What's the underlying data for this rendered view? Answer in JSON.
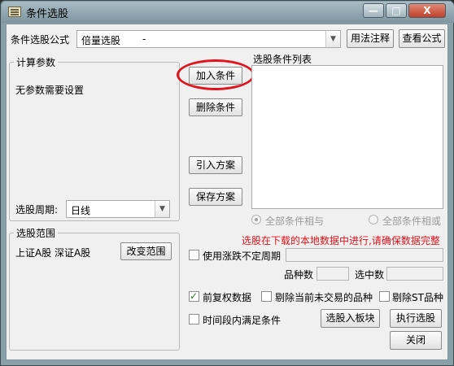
{
  "window": {
    "title": "条件选股",
    "minimize": "—",
    "maximize": "□",
    "close": "X"
  },
  "formula": {
    "label": "条件选股公式",
    "value": "倍量选股",
    "value_suffix": "-",
    "usage_button": "用法注释",
    "view_button": "查看公式"
  },
  "params": {
    "group_label": "计算参数",
    "message": "无参数需要设置",
    "period_label": "选股周期:",
    "period_value": "日线"
  },
  "scope": {
    "group_label": "选股范围",
    "value": "上证A股 深证A股",
    "change_button": "改变范围"
  },
  "actions": {
    "add": "加入条件",
    "delete": "删除条件",
    "import": "引入方案",
    "save": "保存方案"
  },
  "conditions": {
    "list_label": "选股条件列表",
    "all_and": "全部条件相与",
    "all_or": "全部条件相或",
    "all_and_selected": true
  },
  "notice": {
    "text": "选股在下载的本地数据中进行,请确保数据完整",
    "color": "#e0141c"
  },
  "options": {
    "unfixed_period": {
      "label": "使用涨跌不定周期",
      "checked": false
    },
    "count_label": "品种数",
    "selected_label": "选中数",
    "forward_adjust": {
      "label": "前复权数据",
      "checked": true
    },
    "exclude_untraded": {
      "label": "剔除当前未交易的品种",
      "checked": false
    },
    "exclude_st": {
      "label": "剔除ST品种",
      "checked": false
    },
    "time_window": {
      "label": "时间段内满足条件",
      "checked": false
    }
  },
  "bottom": {
    "to_block": "选股入板块",
    "execute": "执行选股",
    "close": "关闭"
  }
}
